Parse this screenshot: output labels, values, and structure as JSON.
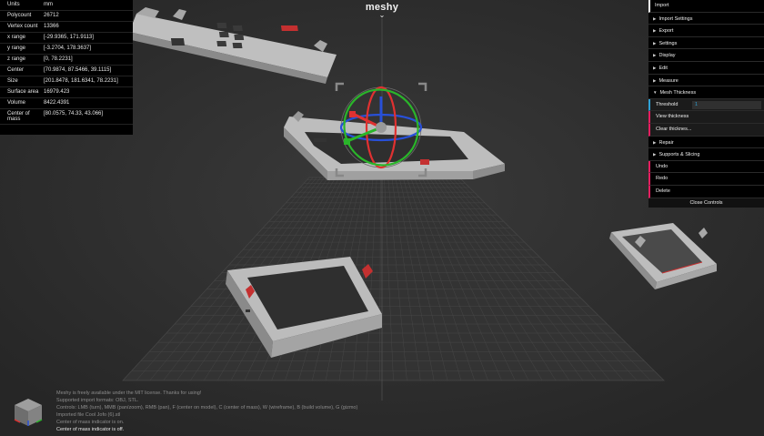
{
  "app": {
    "title": "meshy"
  },
  "info": [
    {
      "label": "Units",
      "value": "mm"
    },
    {
      "label": "Polycount",
      "value": "26712"
    },
    {
      "label": "Vertex count",
      "value": "13366"
    },
    {
      "label": "x range",
      "value": "[-29.9365, 171.9113]"
    },
    {
      "label": "y range",
      "value": "[-3.2704, 178.3637]"
    },
    {
      "label": "z range",
      "value": "[0, 78.2231]"
    },
    {
      "label": "Center",
      "value": "[70.9874, 87.5466, 39.1115]"
    },
    {
      "label": "Size",
      "value": "[201.8478, 181.6341, 78.2231]"
    },
    {
      "label": "Surface area",
      "value": "16979.423"
    },
    {
      "label": "Volume",
      "value": "8422.4391"
    },
    {
      "label": "Center of mass",
      "value": "[80.0575, 74.33, 43.066]"
    }
  ],
  "controls": {
    "folders_top": [
      "Import",
      "Import Settings",
      "Export",
      "Settings",
      "Display",
      "Edit",
      "Measure",
      "Mesh Thickness"
    ],
    "mesh_thickness": {
      "threshold_label": "Threshold",
      "threshold_value": "1",
      "view_label": "View thickness",
      "clear_label": "Clear thicknes..."
    },
    "folders_mid": [
      "Repair",
      "Supports & Slicing"
    ],
    "buttons": [
      "Undo",
      "Redo",
      "Delete"
    ],
    "close_label": "Close Controls"
  },
  "log": [
    {
      "text": "Meshy is freely available under the MIT license. Thanks for using!",
      "style": "dim"
    },
    {
      "text": "Supported import formats: OBJ, STL.",
      "style": "dim"
    },
    {
      "text": "Controls: LMB (turn), MMB (pan/zoom), RMB (pan), F (center on model), C (center of mass), W (wireframe), B (build volume), G (gizmo)",
      "style": "dim"
    },
    {
      "text": "Imported file Cool Jofo (6).stl",
      "style": "dim"
    },
    {
      "text": "Center of mass indicator is on.",
      "style": "dim"
    },
    {
      "text": "Center of mass indicator is off.",
      "style": "bright"
    }
  ],
  "colors": {
    "background": "#2d2d2d",
    "gizmo_red": "#e03131",
    "gizmo_green": "#2ab52a",
    "gizmo_blue": "#2850d8",
    "ui_number": "#2fa1d6",
    "ui_button": "#e61d5f"
  }
}
